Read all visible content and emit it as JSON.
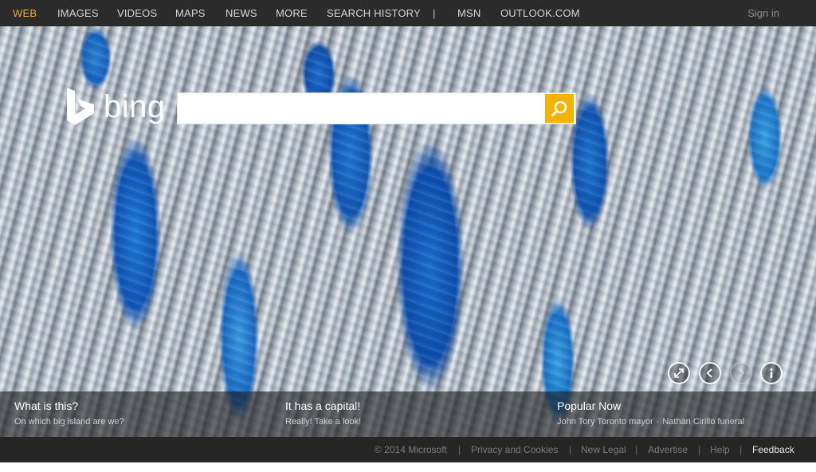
{
  "nav": {
    "items": [
      {
        "label": "WEB",
        "active": true
      },
      {
        "label": "IMAGES"
      },
      {
        "label": "VIDEOS"
      },
      {
        "label": "MAPS"
      },
      {
        "label": "NEWS"
      },
      {
        "label": "MORE"
      },
      {
        "label": "SEARCH HISTORY"
      }
    ],
    "separator": "|",
    "extra": [
      {
        "label": "MSN"
      },
      {
        "label": "OUTLOOK.COM"
      }
    ],
    "signin": "Sign in"
  },
  "logo": {
    "text": "bing"
  },
  "search": {
    "value": "",
    "placeholder": "",
    "button_icon": "search-icon",
    "accent": "#f2b400"
  },
  "controls": [
    {
      "icon": "fullscreen-icon"
    },
    {
      "icon": "chevron-left-icon"
    },
    {
      "icon": "chevron-right-icon",
      "disabled": true
    },
    {
      "icon": "info-icon"
    }
  ],
  "strip": {
    "panels": [
      {
        "title": "What is this?",
        "subtitle": "On which big island are we?"
      },
      {
        "title": "It has a capital!",
        "subtitle": "Really! Take a look!"
      },
      {
        "title": "Popular Now",
        "links": [
          "John Tory Toronto mayor",
          "Nathan Cirillo funeral"
        ],
        "link_sep": "·"
      }
    ]
  },
  "footer": {
    "copyright": "© 2014 Microsoft",
    "links": [
      "Privacy and Cookies",
      "New Legal",
      "Advertise",
      "Help",
      "Feedback"
    ],
    "separator": "|"
  }
}
